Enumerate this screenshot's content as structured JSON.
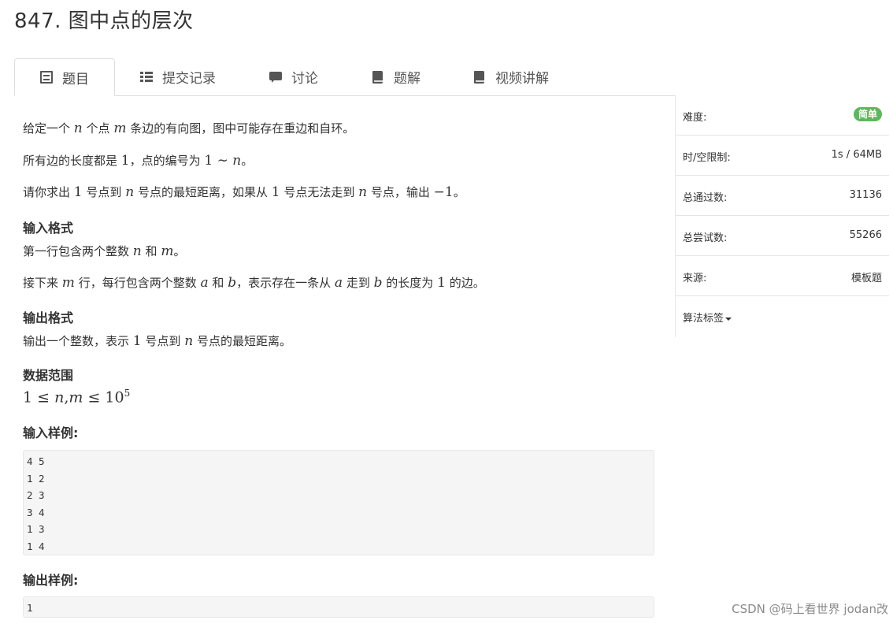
{
  "problem": {
    "title": "847. 图中点的层次"
  },
  "tabs": [
    {
      "label": "题目",
      "icon": "doc-icon",
      "active": true
    },
    {
      "label": "提交记录",
      "icon": "list-icon",
      "active": false
    },
    {
      "label": "讨论",
      "icon": "comment-icon",
      "active": false
    },
    {
      "label": "题解",
      "icon": "book-icon",
      "active": false
    },
    {
      "label": "视频讲解",
      "icon": "book-icon",
      "active": false
    }
  ],
  "description": {
    "p1": {
      "a": "给定一个",
      "n": "n",
      "b": "个点",
      "m": "m",
      "c": "条边的有向图，图中可能存在重边和自环。"
    },
    "p2": {
      "a": "所有边的长度都是",
      "one": "1",
      "b": "，点的编号为",
      "range": "1 ∼ ",
      "n": "n",
      "c": "。"
    },
    "p3": {
      "a": "请你求出",
      "one": "1",
      "b": "号点到",
      "n": "n",
      "c": "号点的最短距离，如果从",
      "one2": "1",
      "d": "号点无法走到",
      "n2": "n",
      "e": "号点，输出",
      "neg": "−1",
      "f": "。"
    }
  },
  "input_format": {
    "heading": "输入格式",
    "l1": {
      "a": "第一行包含两个整数",
      "n": "n",
      "b": "和",
      "m": "m",
      "c": "。"
    },
    "l2": {
      "a": "接下来",
      "m": "m",
      "b": "行，每行包含两个整数",
      "x": "a",
      "c": "和",
      "y": "b",
      "d": "，表示存在一条从",
      "x2": "a",
      "e": "走到",
      "y2": "b",
      "f": "的长度为",
      "one": "1",
      "g": "的边。"
    }
  },
  "output_format": {
    "heading": "输出格式",
    "l1": {
      "a": "输出一个整数，表示",
      "one": "1",
      "b": "号点到",
      "n": "n",
      "c": "号点的最短距离。"
    }
  },
  "data_range": {
    "heading": "数据范围",
    "lhs": "1 ≤ ",
    "n": "n",
    "comma": ",",
    "m": "m",
    "rel": " ≤ 10",
    "exp": "5"
  },
  "sample_input": {
    "heading": "输入样例:",
    "lines": [
      "4 5",
      "1 2",
      "2 3",
      "3 4",
      "1 3",
      "1 4"
    ]
  },
  "sample_output": {
    "heading": "输出样例:",
    "lines": [
      "1"
    ]
  },
  "sidebar": {
    "difficulty": {
      "label": "难度:",
      "value": "简单",
      "color": "#5cb85c"
    },
    "limits": {
      "label": "时/空限制:",
      "value": "1s / 64MB"
    },
    "accepted": {
      "label": "总通过数:",
      "value": "31136"
    },
    "attempts": {
      "label": "总尝试数:",
      "value": "55266"
    },
    "source": {
      "label": "来源:",
      "value": "模板题"
    },
    "tags": {
      "label": "算法标签"
    }
  },
  "watermark": "CSDN @码上看世界 jodan改"
}
